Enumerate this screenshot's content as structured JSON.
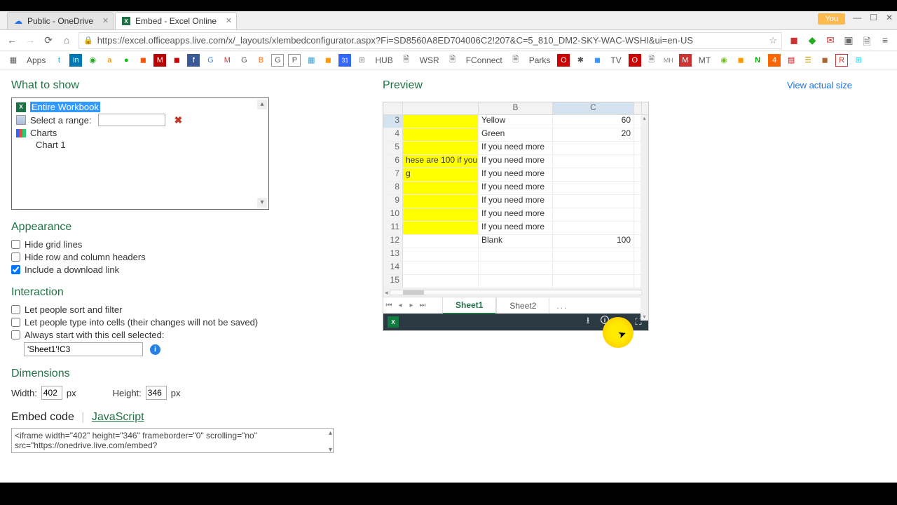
{
  "browser": {
    "tabs": [
      {
        "title": "Public - OneDrive",
        "active": false
      },
      {
        "title": "Embed - Excel Online",
        "active": true
      }
    ],
    "url": "https://excel.officeapps.live.com/x/_layouts/xlembedconfigurator.aspx?Fi=SD8560A8ED704006C2!207&C=5_810_DM2-SKY-WAC-WSHI&ui=en-US",
    "you_badge": "You",
    "win_min": "—",
    "win_max": "☐",
    "win_close": "✕",
    "apps_label": "Apps",
    "bookmarks": [
      "HUB",
      "WSR",
      "FConnect",
      "Parks",
      "TV",
      "MT"
    ]
  },
  "sections": {
    "what_to_show": "What to show",
    "appearance": "Appearance",
    "interaction": "Interaction",
    "dimensions": "Dimensions",
    "embed_code": "Embed code",
    "javascript": "JavaScript",
    "preview": "Preview",
    "view_actual": "View actual size"
  },
  "selector": {
    "entire_workbook": "Entire Workbook",
    "select_range": "Select a range:",
    "charts": "Charts",
    "chart1": "Chart 1"
  },
  "appearance": {
    "hide_grid": "Hide grid lines",
    "hide_headers": "Hide row and column headers",
    "download_link": "Include a download link"
  },
  "interaction": {
    "sort_filter": "Let people sort and filter",
    "type_cells": "Let people type into cells (their changes will not be saved)",
    "start_cell": "Always start with this cell selected:",
    "start_cell_val": "'Sheet1'!C3"
  },
  "dimensions": {
    "width_lbl": "Width:",
    "height_lbl": "Height:",
    "px": "px",
    "width": "402",
    "height": "346"
  },
  "embed": {
    "code": "<iframe width=\"402\" height=\"346\" frameborder=\"0\" scrolling=\"no\" src=\"https://onedrive.live.com/embed?"
  },
  "grid": {
    "cols": {
      "B": "B",
      "C": "C"
    },
    "rows": [
      {
        "n": 3,
        "a": "",
        "b": "Yellow",
        "c": "60",
        "yellow": true,
        "selected": true
      },
      {
        "n": 4,
        "a": "",
        "b": "Green",
        "c": "20",
        "yellow": true
      },
      {
        "n": 5,
        "a": "",
        "b": "If you need more",
        "c": "",
        "yellow": true
      },
      {
        "n": 6,
        "a": "hese are 100 if you",
        "b": "If you need more",
        "c": "",
        "yellow": true
      },
      {
        "n": 7,
        "a": "g",
        "b": "If you need more",
        "c": "",
        "yellow": true
      },
      {
        "n": 8,
        "a": "",
        "b": "If you need more",
        "c": "",
        "yellow": true
      },
      {
        "n": 9,
        "a": "",
        "b": "If you need more",
        "c": "",
        "yellow": true
      },
      {
        "n": 10,
        "a": "",
        "b": "If you need more",
        "c": "",
        "yellow": true
      },
      {
        "n": 11,
        "a": "",
        "b": "If you need more",
        "c": "",
        "yellow": true
      },
      {
        "n": 12,
        "a": "",
        "b": "Blank",
        "c": "100",
        "yellow": false
      },
      {
        "n": 13,
        "a": "",
        "b": "",
        "c": "",
        "yellow": false
      },
      {
        "n": 14,
        "a": "",
        "b": "",
        "c": "",
        "yellow": false
      },
      {
        "n": 15,
        "a": "",
        "b": "",
        "c": "",
        "yellow": false
      }
    ],
    "sheet1": "Sheet1",
    "sheet2": "Sheet2",
    "more": "..."
  }
}
